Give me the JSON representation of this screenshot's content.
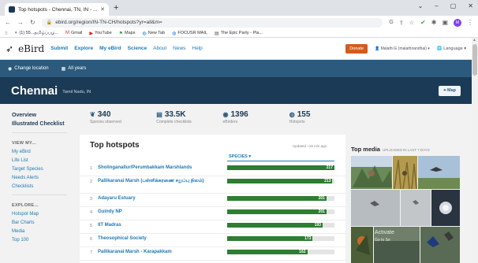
{
  "browser": {
    "tab_title": "Top hotspots - Chennai, TN, IN - ...",
    "url": "ebird.org/region/IN-TN-CH/hotspots?yr=all&m=",
    "bookmarks": [
      {
        "icon": "g-icon",
        "label": "(1) 55...தமிழ்ப்பழ..."
      },
      {
        "icon": "gmail-icon",
        "label": "Gmail"
      },
      {
        "icon": "youtube-icon",
        "label": "YouTube"
      },
      {
        "icon": "maps-icon",
        "label": "Maps"
      },
      {
        "icon": "globe-icon",
        "label": "New Tab"
      },
      {
        "icon": "globe-icon",
        "label": "FOCUSR MAIL"
      },
      {
        "icon": "bookmark-icon",
        "label": "The Epic Party - Pla..."
      }
    ]
  },
  "header": {
    "logo_text": "eBird",
    "nav": [
      "Submit",
      "Explore",
      "My eBird",
      "Science",
      "About",
      "News",
      "Help"
    ],
    "donate_label": "Donate",
    "user_label": "Malathi E (malathirandhai)",
    "language_label": "Language"
  },
  "region_bar": {
    "change_location": "Change location",
    "years": "All years"
  },
  "region": {
    "name": "Chennai",
    "subtitle": "Tamil Nadu, IN",
    "map_label": "Map"
  },
  "sidebar": {
    "overview": "Overview",
    "checklist": "Illustrated Checklist",
    "view_my_heading": "VIEW MY...",
    "view_my": [
      "My eBird",
      "Life List",
      "Target Species",
      "Needs Alerts",
      "Checklists"
    ],
    "explore_heading": "EXPLORE...",
    "explore": [
      "Hotspot Map",
      "Bar Charts",
      "Media",
      "Top 100"
    ]
  },
  "stats": [
    {
      "icon": "species-icon",
      "value": "340",
      "label": "Species observed"
    },
    {
      "icon": "checklist-icon",
      "value": "33.5K",
      "label": "Complete checklists"
    },
    {
      "icon": "people-icon",
      "value": "1396",
      "label": "eBirders"
    },
    {
      "icon": "hotspot-icon",
      "value": "155",
      "label": "Hotspots"
    }
  ],
  "hotspots": {
    "title": "Top hotspots",
    "updated": "Updated ~19 min ago",
    "species_header": "SPECIES",
    "max": 217,
    "rows": [
      {
        "rank": "1",
        "name": "Sholinganallur/Perumbakkam Marshlands",
        "species": 217
      },
      {
        "rank": "2",
        "name": "Pallikaranai Marsh (பள்ளிக்கரணை சதுப்பு நிலம்)",
        "species": 213
      },
      {
        "rank": "3",
        "name": "Adayaru Estuary",
        "species": 201
      },
      {
        "rank": "4",
        "name": "Guindy NP",
        "species": 201
      },
      {
        "rank": "5",
        "name": "IIT Madras",
        "species": 193
      },
      {
        "rank": "6",
        "name": "Theosophical Society",
        "species": 173
      },
      {
        "rank": "7",
        "name": "Pallikaranai Marsh - Karapakkam",
        "species": 162
      }
    ]
  },
  "media": {
    "title": "Top media",
    "subtitle": "UPLOADED IN LAST 7 DAYS",
    "watermark_line1": "Activate",
    "watermark_line2": "Go to Se"
  },
  "colors": {
    "navy": "#1b3a55",
    "blue_bar": "#2c5a7c",
    "link": "#1c7ab5",
    "species_bar": "#2e7d32",
    "donate": "#d15d1c"
  }
}
